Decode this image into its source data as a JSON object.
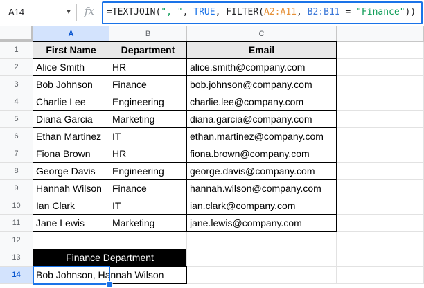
{
  "namebox": {
    "value": "A14",
    "caret": "▼"
  },
  "formula": {
    "fx_label": "fx",
    "parts": [
      "=TEXTJOIN(",
      "\", \"",
      ", ",
      "TRUE",
      ", FILTER(",
      "A2:A11",
      ", ",
      "B2:B11",
      " = ",
      "\"Finance\"",
      "))"
    ]
  },
  "columns": [
    "A",
    "B",
    "C"
  ],
  "rows": [
    "1",
    "2",
    "3",
    "4",
    "5",
    "6",
    "7",
    "8",
    "9",
    "10",
    "11",
    "12",
    "13",
    "14"
  ],
  "table": {
    "headers": [
      "First Name",
      "Department",
      "Email"
    ],
    "data": [
      [
        "Alice Smith",
        "HR",
        "alice.smith@company.com"
      ],
      [
        "Bob Johnson",
        "Finance",
        "bob.johnson@company.com"
      ],
      [
        "Charlie Lee",
        "Engineering",
        "charlie.lee@company.com"
      ],
      [
        "Diana Garcia",
        "Marketing",
        "diana.garcia@company.com"
      ],
      [
        "Ethan Martinez",
        "IT",
        "ethan.martinez@company.com"
      ],
      [
        "Fiona Brown",
        "HR",
        "fiona.brown@company.com"
      ],
      [
        "George Davis",
        "Engineering",
        "george.davis@company.com"
      ],
      [
        "Hannah Wilson",
        "Finance",
        "hannah.wilson@company.com"
      ],
      [
        "Ian Clark",
        "IT",
        "ian.clark@company.com"
      ],
      [
        "Jane Lewis",
        "Marketing",
        "jane.lewis@company.com"
      ]
    ]
  },
  "summary": {
    "title": "Finance Department",
    "result": "Bob Johnson, Hannah Wilson"
  },
  "colors": {
    "accent": "#1a73e8",
    "header_fill": "#e8e8e8",
    "title_fill": "#000000",
    "selected_header": "#d3e3fd"
  }
}
